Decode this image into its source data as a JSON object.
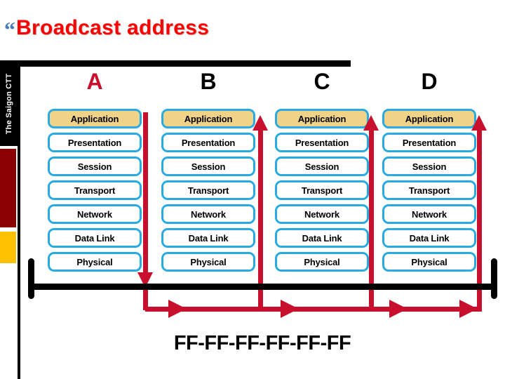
{
  "slide": {
    "title": "Broadcast address",
    "bullet_glyph": "“",
    "title_color": "#FF0000",
    "bullet_color": "#4A7EBB"
  },
  "sidebar": {
    "brand_label": "The Saigon CTT",
    "block_colors": {
      "black": "#000000",
      "dark_red": "#8B0000",
      "gold": "#FFC000"
    }
  },
  "diagram": {
    "layer_names": [
      "Application",
      "Presentation",
      "Session",
      "Transport",
      "Network",
      "Data Link",
      "Physical"
    ],
    "highlighted_layer": "Application",
    "accent_colors": {
      "layer_border": "#29ABE2",
      "highlight_fill": "#F0D388",
      "traffic_red": "#C8102E",
      "bus_black": "#000000"
    },
    "nodes": [
      {
        "letter": "A",
        "letter_color": "#C8102E",
        "role": "sender",
        "arrow_direction": "down"
      },
      {
        "letter": "B",
        "letter_color": "#000000",
        "role": "receiver",
        "arrow_direction": "up"
      },
      {
        "letter": "C",
        "letter_color": "#000000",
        "role": "receiver",
        "arrow_direction": "up"
      },
      {
        "letter": "D",
        "letter_color": "#000000",
        "role": "receiver",
        "arrow_direction": "up"
      }
    ],
    "broadcast_address": "FF-FF-FF-FF-FF-FF"
  }
}
